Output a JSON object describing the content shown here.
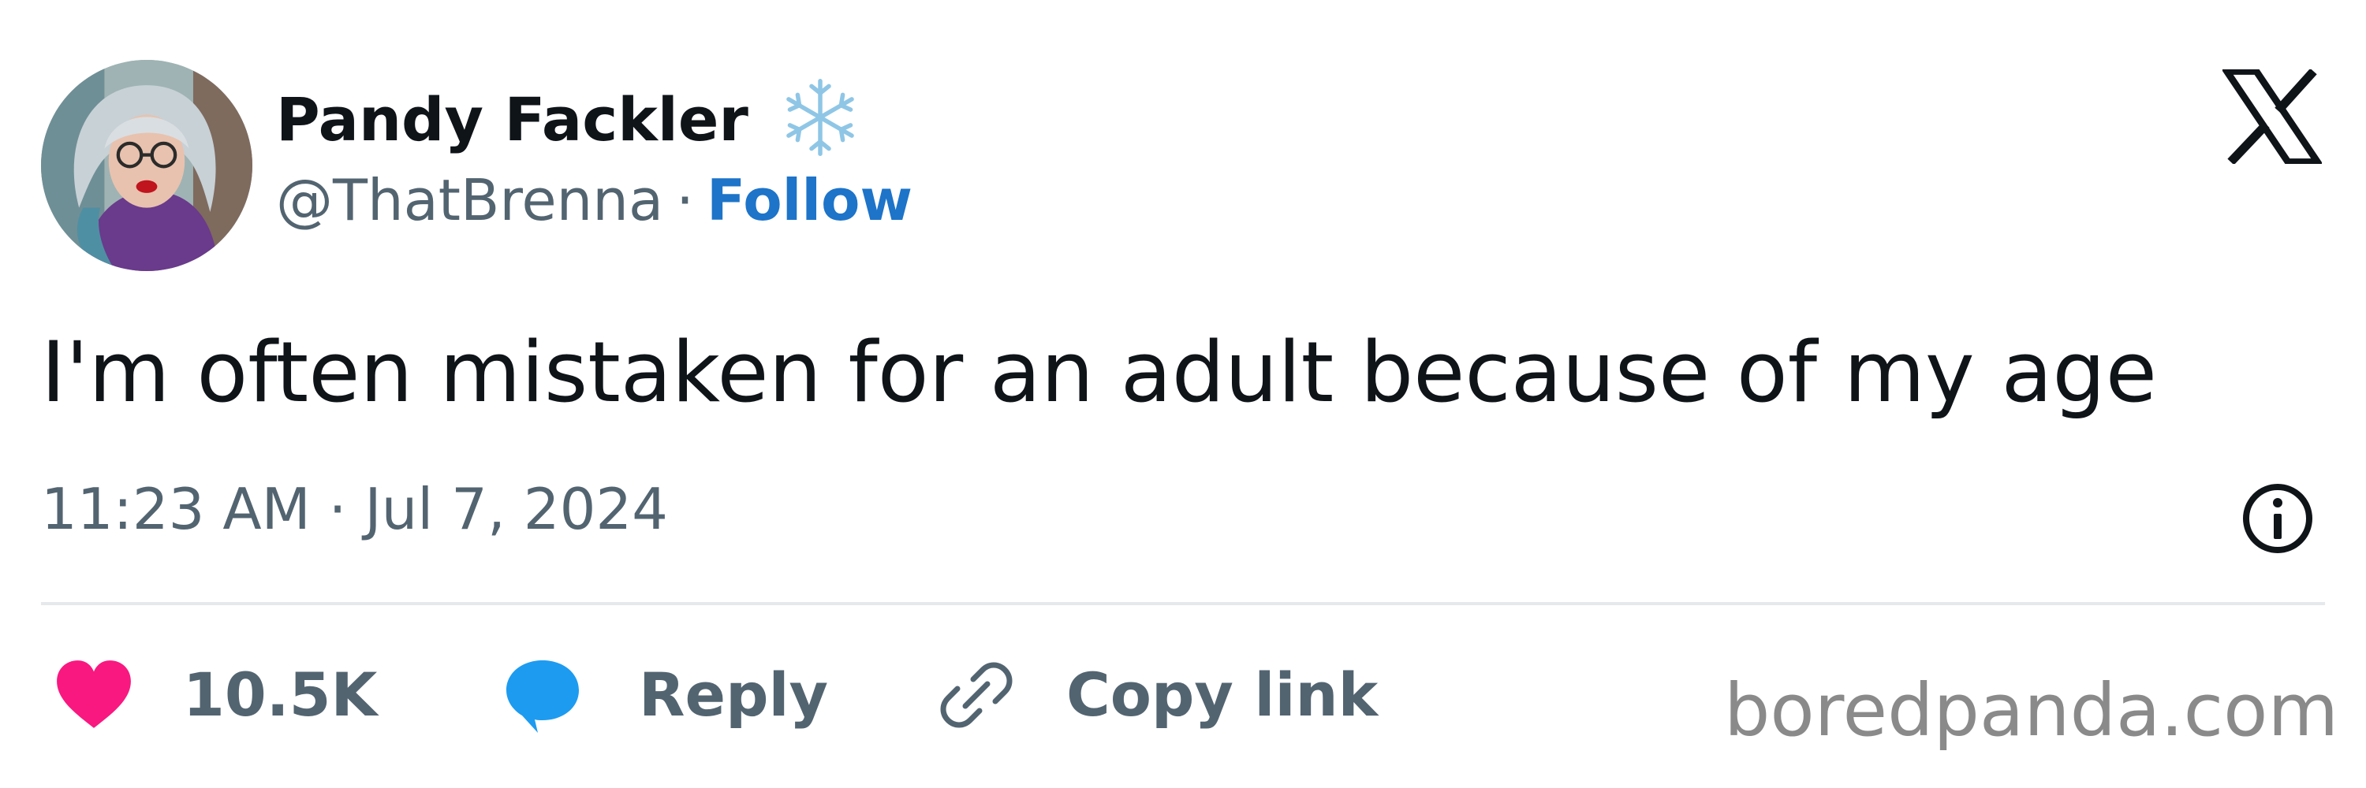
{
  "author": {
    "display_name": "Pandy Fackler",
    "handle": "@ThatBrenna",
    "separator": "·",
    "follow_label": "Follow",
    "badge_icon": "snowflake-icon",
    "follow_color": "#1d74c9"
  },
  "tweet": {
    "text": "I'm often mistaken for an adult because of my age",
    "timestamp": "11:23 AM · Jul 7, 2024"
  },
  "actions": {
    "likes_count": "10.5K",
    "like_color": "#f91880",
    "reply_label": "Reply",
    "reply_color": "#1d9bf0",
    "copy_link_label": "Copy link"
  },
  "watermark": "boredpanda.com",
  "icons": [
    "x-logo-icon",
    "info-icon",
    "heart-icon",
    "speech-bubble-icon",
    "link-icon"
  ]
}
